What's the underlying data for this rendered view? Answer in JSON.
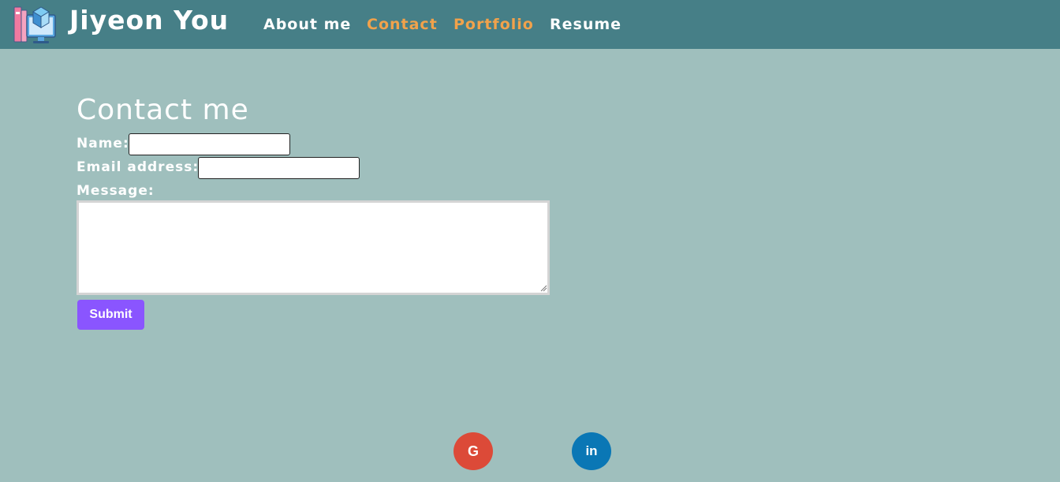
{
  "header": {
    "brand": "Jiyeon You",
    "logo_icon": "books-monitor-icon",
    "nav": [
      {
        "label": "About me",
        "color": "#ffffff"
      },
      {
        "label": "Contact",
        "color": "#f1a24b"
      },
      {
        "label": "Portfolio",
        "color": "#f1a24b"
      },
      {
        "label": "Resume",
        "color": "#ffffff"
      }
    ]
  },
  "main": {
    "heading": "Contact me",
    "form": {
      "name_label": "Name:",
      "name_value": "",
      "email_label": "Email address:",
      "email_value": "",
      "message_label": "Message:",
      "message_value": "",
      "submit_label": "Submit"
    }
  },
  "footer": {
    "social": [
      {
        "icon": "google-icon",
        "glyph": "G",
        "color": "#dc4a38"
      },
      {
        "icon": "linkedin-icon",
        "glyph": "in",
        "color": "#0a77b5"
      }
    ]
  },
  "colors": {
    "background": "#9fbfbd",
    "header": "#467f87",
    "accent": "#f1a24b",
    "button": "#8a55ff"
  }
}
